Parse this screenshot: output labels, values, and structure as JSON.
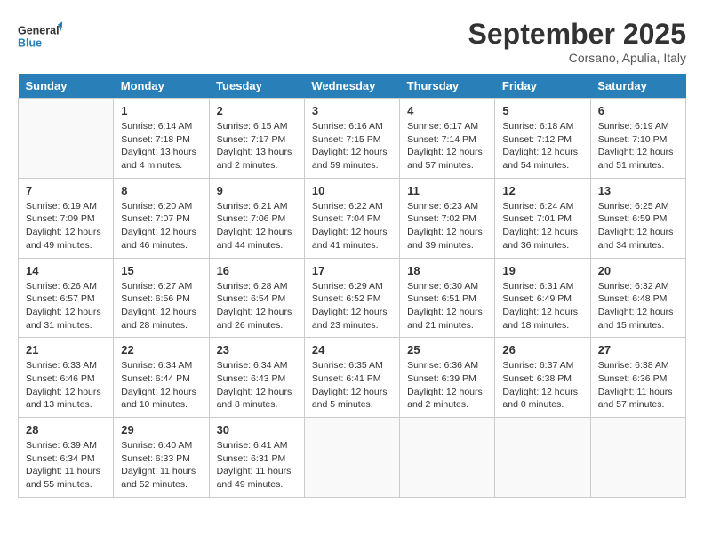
{
  "header": {
    "logo_line1": "General",
    "logo_line2": "Blue",
    "month_title": "September 2025",
    "subtitle": "Corsano, Apulia, Italy"
  },
  "days_of_week": [
    "Sunday",
    "Monday",
    "Tuesday",
    "Wednesday",
    "Thursday",
    "Friday",
    "Saturday"
  ],
  "weeks": [
    [
      {
        "day": "",
        "sunrise": "",
        "sunset": "",
        "daylight": ""
      },
      {
        "day": "1",
        "sunrise": "6:14 AM",
        "sunset": "7:18 PM",
        "daylight": "13 hours and 4 minutes."
      },
      {
        "day": "2",
        "sunrise": "6:15 AM",
        "sunset": "7:17 PM",
        "daylight": "13 hours and 2 minutes."
      },
      {
        "day": "3",
        "sunrise": "6:16 AM",
        "sunset": "7:15 PM",
        "daylight": "12 hours and 59 minutes."
      },
      {
        "day": "4",
        "sunrise": "6:17 AM",
        "sunset": "7:14 PM",
        "daylight": "12 hours and 57 minutes."
      },
      {
        "day": "5",
        "sunrise": "6:18 AM",
        "sunset": "7:12 PM",
        "daylight": "12 hours and 54 minutes."
      },
      {
        "day": "6",
        "sunrise": "6:19 AM",
        "sunset": "7:10 PM",
        "daylight": "12 hours and 51 minutes."
      }
    ],
    [
      {
        "day": "7",
        "sunrise": "6:19 AM",
        "sunset": "7:09 PM",
        "daylight": "12 hours and 49 minutes."
      },
      {
        "day": "8",
        "sunrise": "6:20 AM",
        "sunset": "7:07 PM",
        "daylight": "12 hours and 46 minutes."
      },
      {
        "day": "9",
        "sunrise": "6:21 AM",
        "sunset": "7:06 PM",
        "daylight": "12 hours and 44 minutes."
      },
      {
        "day": "10",
        "sunrise": "6:22 AM",
        "sunset": "7:04 PM",
        "daylight": "12 hours and 41 minutes."
      },
      {
        "day": "11",
        "sunrise": "6:23 AM",
        "sunset": "7:02 PM",
        "daylight": "12 hours and 39 minutes."
      },
      {
        "day": "12",
        "sunrise": "6:24 AM",
        "sunset": "7:01 PM",
        "daylight": "12 hours and 36 minutes."
      },
      {
        "day": "13",
        "sunrise": "6:25 AM",
        "sunset": "6:59 PM",
        "daylight": "12 hours and 34 minutes."
      }
    ],
    [
      {
        "day": "14",
        "sunrise": "6:26 AM",
        "sunset": "6:57 PM",
        "daylight": "12 hours and 31 minutes."
      },
      {
        "day": "15",
        "sunrise": "6:27 AM",
        "sunset": "6:56 PM",
        "daylight": "12 hours and 28 minutes."
      },
      {
        "day": "16",
        "sunrise": "6:28 AM",
        "sunset": "6:54 PM",
        "daylight": "12 hours and 26 minutes."
      },
      {
        "day": "17",
        "sunrise": "6:29 AM",
        "sunset": "6:52 PM",
        "daylight": "12 hours and 23 minutes."
      },
      {
        "day": "18",
        "sunrise": "6:30 AM",
        "sunset": "6:51 PM",
        "daylight": "12 hours and 21 minutes."
      },
      {
        "day": "19",
        "sunrise": "6:31 AM",
        "sunset": "6:49 PM",
        "daylight": "12 hours and 18 minutes."
      },
      {
        "day": "20",
        "sunrise": "6:32 AM",
        "sunset": "6:48 PM",
        "daylight": "12 hours and 15 minutes."
      }
    ],
    [
      {
        "day": "21",
        "sunrise": "6:33 AM",
        "sunset": "6:46 PM",
        "daylight": "12 hours and 13 minutes."
      },
      {
        "day": "22",
        "sunrise": "6:34 AM",
        "sunset": "6:44 PM",
        "daylight": "12 hours and 10 minutes."
      },
      {
        "day": "23",
        "sunrise": "6:34 AM",
        "sunset": "6:43 PM",
        "daylight": "12 hours and 8 minutes."
      },
      {
        "day": "24",
        "sunrise": "6:35 AM",
        "sunset": "6:41 PM",
        "daylight": "12 hours and 5 minutes."
      },
      {
        "day": "25",
        "sunrise": "6:36 AM",
        "sunset": "6:39 PM",
        "daylight": "12 hours and 2 minutes."
      },
      {
        "day": "26",
        "sunrise": "6:37 AM",
        "sunset": "6:38 PM",
        "daylight": "12 hours and 0 minutes."
      },
      {
        "day": "27",
        "sunrise": "6:38 AM",
        "sunset": "6:36 PM",
        "daylight": "11 hours and 57 minutes."
      }
    ],
    [
      {
        "day": "28",
        "sunrise": "6:39 AM",
        "sunset": "6:34 PM",
        "daylight": "11 hours and 55 minutes."
      },
      {
        "day": "29",
        "sunrise": "6:40 AM",
        "sunset": "6:33 PM",
        "daylight": "11 hours and 52 minutes."
      },
      {
        "day": "30",
        "sunrise": "6:41 AM",
        "sunset": "6:31 PM",
        "daylight": "11 hours and 49 minutes."
      },
      {
        "day": "",
        "sunrise": "",
        "sunset": "",
        "daylight": ""
      },
      {
        "day": "",
        "sunrise": "",
        "sunset": "",
        "daylight": ""
      },
      {
        "day": "",
        "sunrise": "",
        "sunset": "",
        "daylight": ""
      },
      {
        "day": "",
        "sunrise": "",
        "sunset": "",
        "daylight": ""
      }
    ]
  ]
}
